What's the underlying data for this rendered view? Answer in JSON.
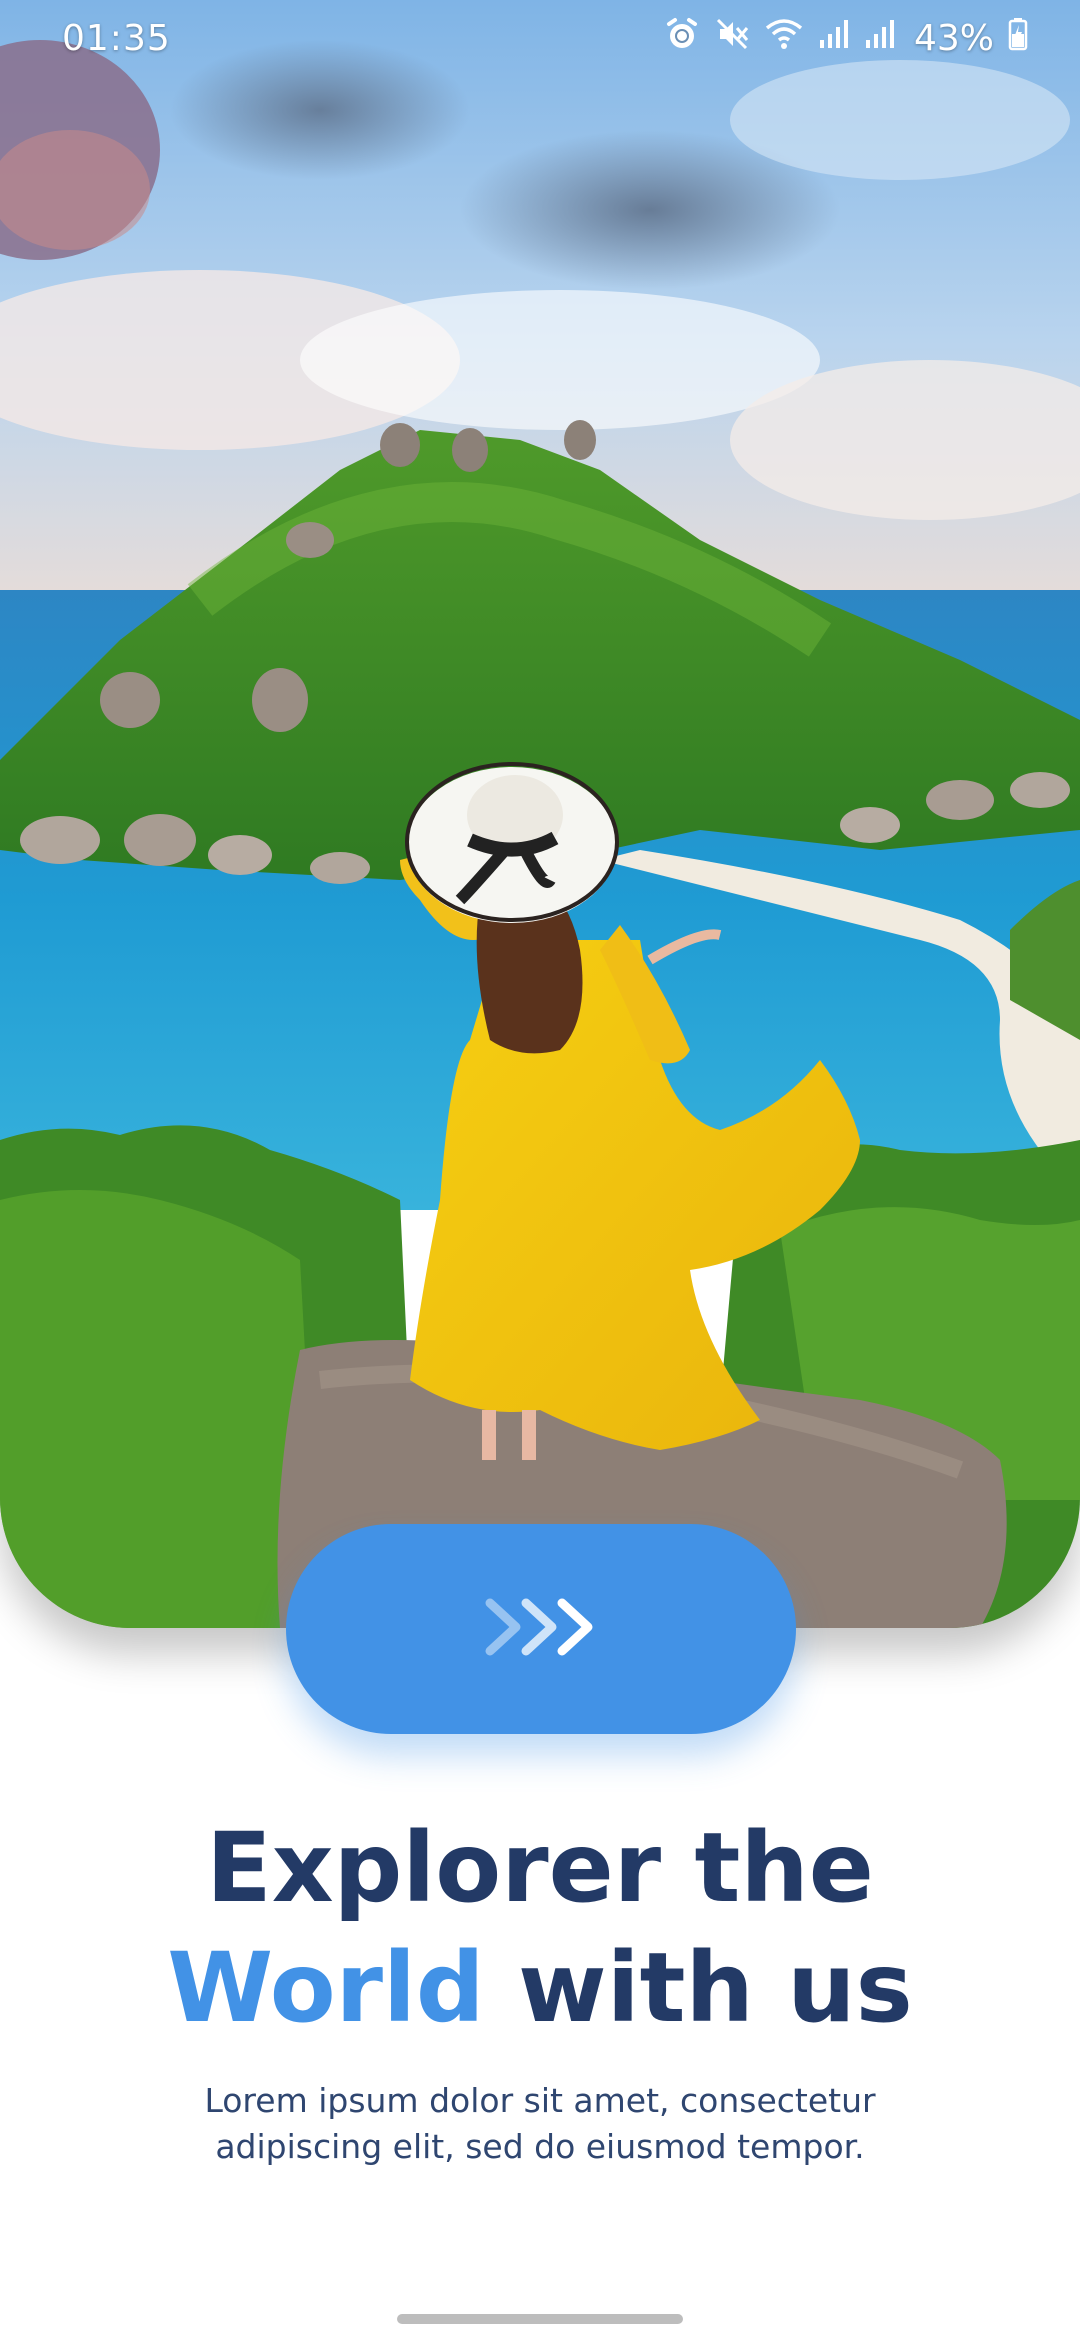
{
  "status_bar": {
    "time": "01:35",
    "battery": "43%",
    "icons": [
      "alarm-icon",
      "mute-icon",
      "wifi-icon",
      "signal-icon",
      "signal-icon",
      "battery-charging-icon"
    ]
  },
  "hero": {
    "image": "woman-in-yellow-dress-on-tropical-island"
  },
  "next_button": {
    "icon": "triple-chevron-right-icon",
    "color": "#4292e6"
  },
  "headline": {
    "line1": "Explorer the",
    "line2_accent": "World",
    "line2_rest": " with us",
    "color": "#233a66",
    "accent_color": "#4292e6"
  },
  "subtitle": {
    "line1": "Lorem ipsum dolor sit amet, consectetur",
    "line2": "adipiscing elit, sed do eiusmod tempor."
  }
}
